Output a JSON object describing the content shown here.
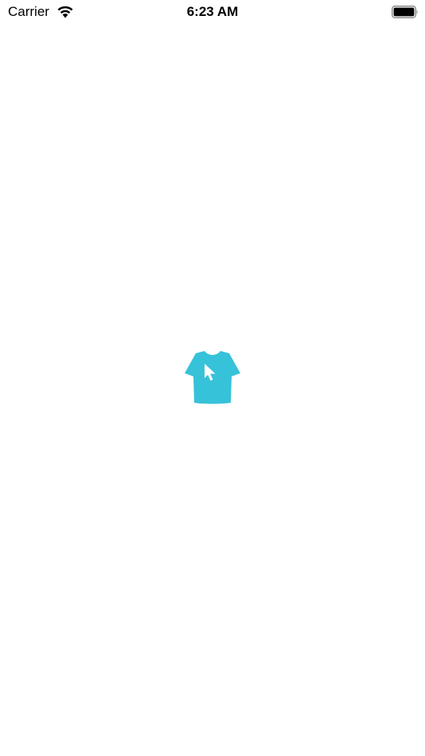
{
  "status_bar": {
    "carrier": "Carrier",
    "time": "6:23 AM",
    "wifi_icon": "wifi-icon",
    "battery_icon": "battery-full-icon"
  },
  "splash": {
    "logo_icon": "tshirt-cursor-icon",
    "logo_color": "#36C2D8"
  }
}
